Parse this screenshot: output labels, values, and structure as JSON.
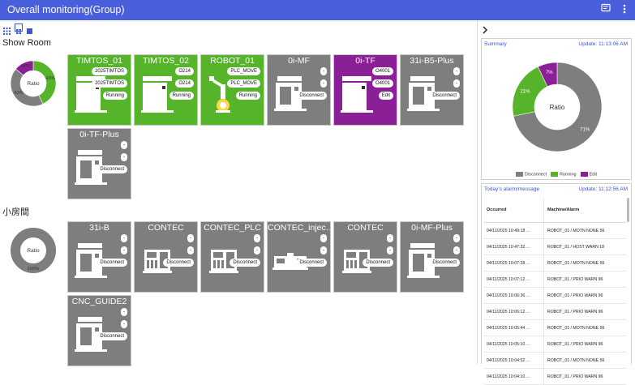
{
  "app": {
    "title": "Overall monitoring(Group)"
  },
  "groups": [
    {
      "name": "Show Room",
      "ratio": {
        "label": "Ratio",
        "running_pct": 43,
        "disconnect_pct": 43,
        "edit_pct": 14,
        "labels": {
          "running": "43%",
          "disconnect": "43%",
          "edit": "14%"
        }
      },
      "machines": [
        {
          "name": "TIMTOS_01",
          "status": "running",
          "icon": "lathe-icon",
          "pills": [
            "2025TIMTOS",
            "2025TIMTOS",
            "Running"
          ]
        },
        {
          "name": "TIMTOS_02",
          "status": "running",
          "icon": "lathe-icon",
          "pills": [
            "O214",
            "O214",
            "Running"
          ]
        },
        {
          "name": "ROBOT_01",
          "status": "running",
          "icon": "robot-icon",
          "pills": [
            "PLC_MOVE",
            "PLC_MOVE",
            "Running"
          ]
        },
        {
          "name": "0i-MF",
          "status": "disconnect",
          "icon": "mill-icon",
          "pills": [
            "-",
            "-",
            "Disconnect"
          ]
        },
        {
          "name": "0i-TF",
          "status": "edit",
          "icon": "lathe-icon",
          "pills": [
            "O4001",
            "O4001",
            "Edit"
          ]
        },
        {
          "name": "31i-B5-Plus",
          "status": "disconnect",
          "icon": "mill-icon",
          "pills": [
            "-",
            "-",
            "Disconnect"
          ]
        },
        {
          "name": "0i-TF-Plus",
          "status": "disconnect",
          "icon": "mill-icon",
          "pills": [
            "-",
            "-",
            "Disconnect"
          ]
        }
      ]
    },
    {
      "name": "小房間",
      "ratio": {
        "label": "Ratio",
        "disconnect_pct": 100,
        "labels": {
          "disconnect": "100%"
        }
      },
      "machines": [
        {
          "name": "31i-B",
          "status": "disconnect",
          "icon": "mill-icon",
          "pills": [
            "-",
            "-",
            "Disconnect"
          ]
        },
        {
          "name": "CONTEC",
          "status": "disconnect",
          "icon": "controller-icon",
          "pills": [
            "-",
            "-",
            "Disconnect"
          ]
        },
        {
          "name": "CONTEC_PLC",
          "status": "disconnect",
          "icon": "controller-icon",
          "pills": [
            "-",
            "-",
            "Disconnect"
          ]
        },
        {
          "name": "CONTEC_injec…",
          "status": "disconnect",
          "icon": "injection-icon",
          "pills": [
            "-",
            "-",
            "Disconnect"
          ]
        },
        {
          "name": "CONTEC",
          "status": "disconnect",
          "icon": "controller-icon",
          "pills": [
            "-",
            "-",
            "Disconnect"
          ]
        },
        {
          "name": "0i-MF-Plus",
          "status": "disconnect",
          "icon": "mill-icon",
          "pills": [
            "-",
            "-",
            "Disconnect"
          ]
        },
        {
          "name": "CNC_GUIDE2",
          "status": "disconnect",
          "icon": "mill-icon",
          "pills": [
            "-",
            "-",
            "Disconnect"
          ]
        }
      ]
    }
  ],
  "summary": {
    "title": "Summary",
    "update": "Update: 11:13:06 AM",
    "center_label": "Ratio",
    "slices": [
      {
        "name": "Disconnect",
        "value": 71,
        "label": "71%",
        "color": "#7e7e7e"
      },
      {
        "name": "Running",
        "value": 21,
        "label": "21%",
        "color": "#55b42a"
      },
      {
        "name": "Edit",
        "value": 7,
        "label": "7%",
        "color": "#8a1f96"
      }
    ]
  },
  "alarms": {
    "title": "Today's alarm/message",
    "update": "Update: 11:12:56 AM",
    "columns": [
      "Occurred",
      "Machine/Alarm"
    ],
    "rows": [
      [
        "04/11/2025 10:49:18 ...",
        "ROBOT_01 / MOTN NONE 56"
      ],
      [
        "04/11/2025 10:47:32 ...",
        "ROBOT_01 / HOST WARN 18"
      ],
      [
        "04/11/2025 10:07:28 ...",
        "ROBOT_01 / MOTN NONE 56"
      ],
      [
        "04/11/2025 10:07:12 ...",
        "ROBOT_01 / PRIO WARN 96"
      ],
      [
        "04/11/2025 10:06:36 ...",
        "ROBOT_01 / PRIO WARN 96"
      ],
      [
        "04/11/2025 10:06:12 ...",
        "ROBOT_01 / PRIO WARN 96"
      ],
      [
        "04/11/2025 10:05:44 ...",
        "ROBOT_01 / MOTN NONE 56"
      ],
      [
        "04/11/2025 10:05:10 ...",
        "ROBOT_01 / PRIO WARN 96"
      ],
      [
        "04/11/2025 10:04:52 ...",
        "ROBOT_01 / MOTN NONE 56"
      ],
      [
        "04/11/2025 10:04:10 ...",
        "ROBOT_01 / PRIO WARN 96"
      ]
    ]
  },
  "colors": {
    "titlebar": "#4a5fdc",
    "running": "#55b42a",
    "disconnect": "#7e7e7e",
    "edit": "#8a1f96",
    "link": "#3b55d6"
  }
}
